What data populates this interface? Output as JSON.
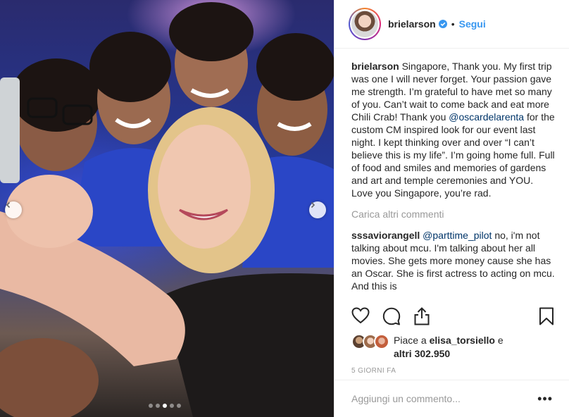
{
  "post": {
    "username": "brielarson",
    "follow_label": "Segui",
    "separator": "•",
    "caption": {
      "author": "brielarson",
      "text_before": " Singapore, Thank you. My first trip was one I will never forget. Your passion gave me strength. I’m grateful to have met so many of you. Can’t wait to come back and eat more Chili Crab! Thank you ",
      "mention": "@oscardelarenta",
      "text_after": " for the custom CM inspired look for our event last night. I kept thinking over and over “I can’t believe this is my life”. I’m going home full. Full of food and smiles and memories of gardens and art and temple ceremonies and YOU. Love you Singapore, you’re rad."
    },
    "load_more_label": "Carica altri commenti",
    "comment": {
      "author": "sssaviorangell",
      "mention": "@parttime_pilot",
      "text": " no, i'm not talking about mcu. I'm talking about her all movies. She gets more money cause she has an Oscar. She is first actress to acting on mcu. And this is"
    },
    "likes": {
      "prefix": "Piace a ",
      "user": "elisa_torsiello",
      "middle": " e",
      "others": "altri 302.950"
    },
    "timestamp": "5 GIORNI FA",
    "add_comment_placeholder": "Aggiungi un commento...",
    "more_options": "•••"
  },
  "carousel": {
    "total": 5,
    "active_index": 3
  },
  "icons": {
    "verified": "verified-badge-icon",
    "like": "heart-icon",
    "comment": "comment-bubble-icon",
    "share": "share-icon",
    "save": "bookmark-icon",
    "prev": "chevron-left-icon",
    "next": "chevron-right-icon"
  },
  "colors": {
    "link": "#3897f0",
    "mention": "#003569",
    "muted": "#999999",
    "verified": "#3897f0"
  }
}
